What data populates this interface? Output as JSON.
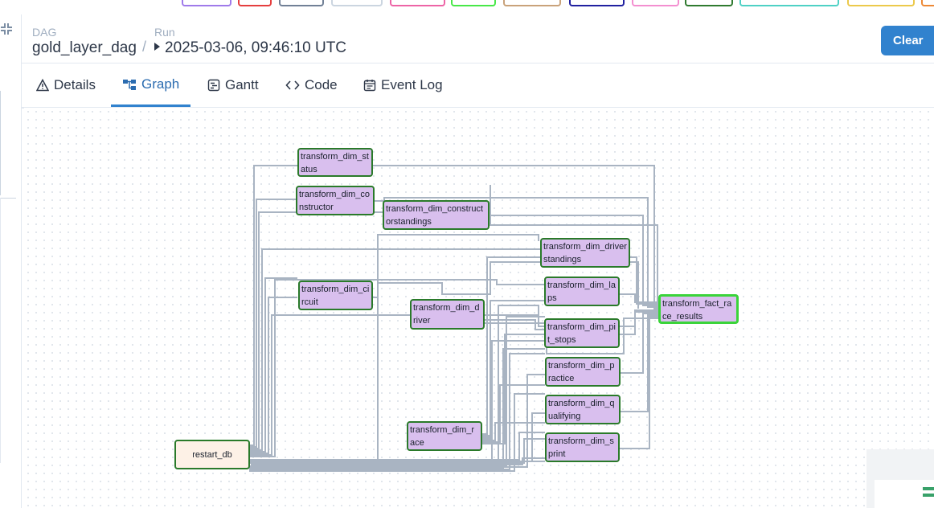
{
  "breadcrumb": {
    "dag_kicker": "DAG",
    "dag_name": "gold_layer_dag",
    "separator": "/",
    "run_kicker": "Run",
    "run_value": "2025-03-06, 09:46:10 UTC"
  },
  "actions": {
    "clear_label": "Clear"
  },
  "tabs": [
    {
      "label": "Details",
      "icon": "warning-triangle-icon"
    },
    {
      "label": "Graph",
      "icon": "graph-icon",
      "active": true
    },
    {
      "label": "Gantt",
      "icon": "gantt-icon"
    },
    {
      "label": "Code",
      "icon": "code-icon"
    },
    {
      "label": "Event Log",
      "icon": "calendar-icon"
    }
  ],
  "graph": {
    "nodes": {
      "status": "transform_dim_status",
      "constructor": "transform_dim_constructor",
      "constructorstandings": "transform_dim_constructorstandings",
      "driverstandings": "transform_dim_driverstandings",
      "laps": "transform_dim_laps",
      "circuit": "transform_dim_circuit",
      "driver": "transform_dim_driver",
      "pit_stops": "transform_dim_pit_stops",
      "practice": "transform_dim_practice",
      "qualifying": "transform_dim_qualifying",
      "race": "transform_dim_race",
      "sprint": "transform_dim_sprint",
      "restart_db": "restart_db",
      "fact": "transform_fact_race_results"
    },
    "colors": {
      "task_fill": "#d9bfee",
      "task_border_success": "#2a7a2a",
      "fact_border": "#3ad43a",
      "restart_fill": "#fdf1e6",
      "edge": "#a9b4c2"
    }
  },
  "legend_colors": [
    "#9f7aea",
    "#e53e3e",
    "#718096",
    "#cbd5e0",
    "#ed64a6",
    "#48e848",
    "#c9a27a",
    "#2020a0",
    "#f38fd0",
    "#2f7a2f",
    "#4fd1c5",
    "#ecc94b",
    "#ed8936"
  ]
}
